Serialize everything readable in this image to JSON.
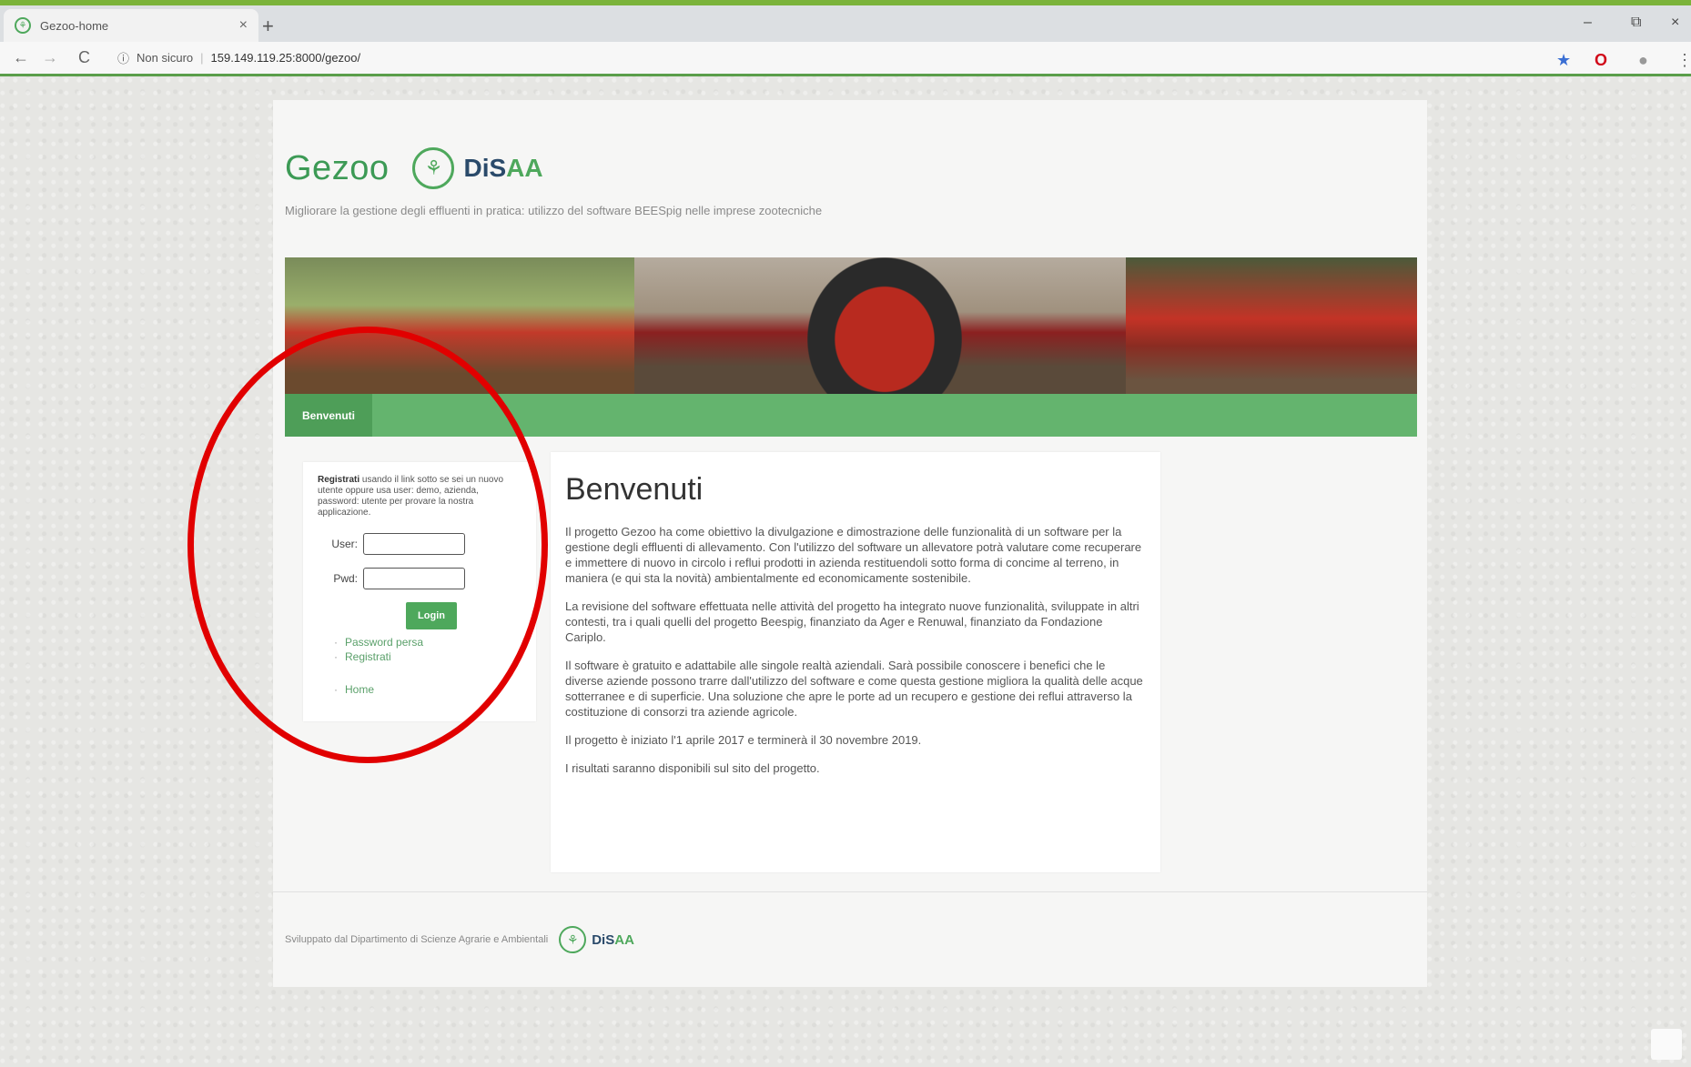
{
  "browser": {
    "tab_title": "Gezoo-home",
    "tab_close": "×",
    "new_tab": "+",
    "url_security": "Non sicuro",
    "url_text": "159.149.119.25:8000/gezoo/",
    "win_min": "–",
    "win_max": "⧉",
    "win_close": "×",
    "nav_back": "←",
    "nav_forward": "→",
    "nav_reload": "C",
    "info_glyph": "ⓘ",
    "url_sep": "|"
  },
  "header": {
    "brand_name": "Gezoo",
    "logo_text_di": "DiS",
    "logo_text_aa": "AA",
    "tagline": "Migliorare la gestione degli effluenti in pratica: utilizzo del software BEESpig nelle imprese zootecniche"
  },
  "nav": {
    "items": [
      {
        "label": "Benvenuti"
      }
    ]
  },
  "login": {
    "intro_bold": "Registrati",
    "intro_text": "usando il link sotto se sei un nuovo utente oppure usa user: demo, azienda, password: utente per provare la nostra applicazione.",
    "user_label": "User:",
    "pass_label": "Pwd:",
    "user_value": "",
    "pass_value": "",
    "button": "Login",
    "links": [
      {
        "label": "Password persa"
      },
      {
        "label": "Registrati"
      },
      {
        "label": "Home"
      }
    ]
  },
  "welcome": {
    "title": "Benvenuti",
    "paragraphs": [
      "Il progetto Gezoo ha come obiettivo la divulgazione e dimostrazione delle funzionalità di un software per la gestione degli effluenti di allevamento. Con l'utilizzo del software un allevatore potrà valutare come recuperare e immettere di nuovo in circolo i reflui prodotti in azienda restituendoli sotto forma di concime al terreno, in maniera (e qui sta la novità) ambientalmente ed economicamente sostenibile.",
      "La revisione del software effettuata nelle attività del progetto ha integrato nuove funzionalità, sviluppate in altri contesti, tra i quali quelli del progetto Beespig, finanziato da Ager e Renuwal, finanziato da Fondazione Cariplo.",
      "Il software è gratuito e adattabile alle singole realtà aziendali. Sarà possibile conoscere i benefici che le diverse aziende possono trarre dall'utilizzo del software e come questa gestione migliora la qualità delle acque sotterranee e di superficie. Una soluzione che apre le porte ad un recupero e gestione dei reflui attraverso la costituzione di consorzi tra aziende agricole.",
      "Il progetto è iniziato l'1 aprile 2017 e terminerà il 30 novembre 2019.",
      "I risultati saranno disponibili sul sito del progetto."
    ]
  },
  "footer": {
    "text": "Sviluppato dal Dipartimento di Scienze Agrarie e Ambientali"
  },
  "colors": {
    "brand_green": "#4ea85c",
    "nav_green": "#64b46e",
    "annotation_red": "#e10000"
  },
  "icons": {
    "logo": "leaf-circle-icon",
    "star": "bookmark-star-icon",
    "opera": "opera-icon",
    "profile": "profile-icon",
    "menu": "kebab-menu-icon"
  }
}
